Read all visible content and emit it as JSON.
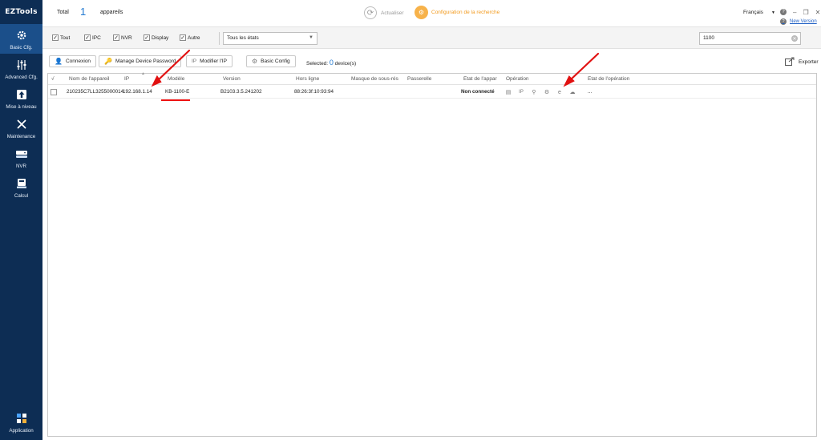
{
  "app": {
    "logo": "EZTools"
  },
  "sidebar": {
    "items": [
      {
        "label": "Basic Cfg.",
        "icon": "gear-icon"
      },
      {
        "label": "Advanced Cfg.",
        "icon": "sliders-icon"
      },
      {
        "label": "Mise à niveau",
        "icon": "upgrade-icon"
      },
      {
        "label": "Maintenance",
        "icon": "tools-icon"
      },
      {
        "label": "NVR",
        "icon": "nvr-icon"
      },
      {
        "label": "Calcul",
        "icon": "calculator-icon"
      }
    ],
    "bottom": {
      "label": "Application",
      "icon": "apps-icon"
    }
  },
  "header": {
    "total_label": "Total",
    "total_count": "1",
    "total_unit": "appareils",
    "refresh_label": "Actualiser",
    "search_config_label": "Configuration de la recherche",
    "language": "Français",
    "new_version": "New Version"
  },
  "filters": {
    "checkboxes": [
      {
        "label": "Tout",
        "checked": true
      },
      {
        "label": "IPC",
        "checked": true
      },
      {
        "label": "NVR",
        "checked": true
      },
      {
        "label": "Display",
        "checked": true
      },
      {
        "label": "Autre",
        "checked": true
      }
    ],
    "status_select": "Tous les états",
    "search_value": "1100"
  },
  "actions": {
    "connect": "Connexion",
    "manage_password": "Manage Device Password",
    "modify_ip": "Modifier l'IP",
    "basic_config": "Basic Config",
    "selected_prefix": "Selected:",
    "selected_count": "0",
    "selected_suffix": "device(s)",
    "export": "Exporter"
  },
  "table": {
    "columns": [
      "√",
      "Nom de l'appareil",
      "IP",
      "Modèle",
      "Version",
      "Hors ligne",
      "Masque de sous-rés",
      "Passerelle",
      "État de l'appar",
      "Opération",
      "État de l'opération"
    ],
    "rows": [
      {
        "name": "210235C7LL3255000014",
        "ip": "192.168.1.14",
        "model": "KB-1100-E",
        "version": "B2103.3.5.241202",
        "offline": "88:26:3f:10:93:94",
        "mask": "",
        "gateway": "",
        "status": "Non connecté",
        "op_state": "..."
      }
    ]
  },
  "colors": {
    "sidebar": "#0d2d54",
    "accent": "#1f78d1",
    "orange": "#f29a1e",
    "arrow": "#e11111"
  }
}
